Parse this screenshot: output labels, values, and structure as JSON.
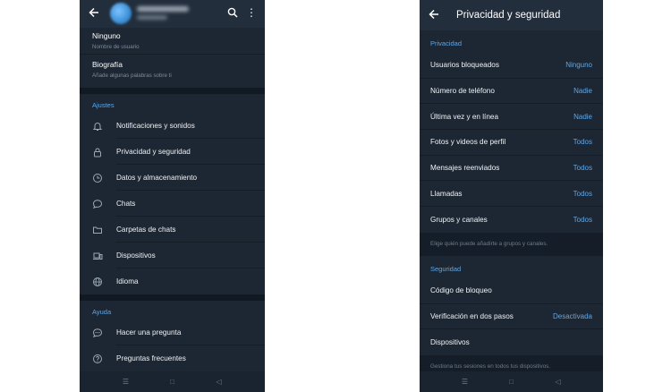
{
  "left_screen": {
    "profile": {
      "username_value": "Ninguno",
      "username_label": "Nombre de usuario",
      "bio_title": "Biografía",
      "bio_hint": "Añade algunas palabras sobre ti"
    },
    "settings_header": "Ajustes",
    "settings_items": [
      {
        "label": "Notificaciones y sonidos",
        "icon": "bell-icon"
      },
      {
        "label": "Privacidad y seguridad",
        "icon": "lock-icon"
      },
      {
        "label": "Datos y almacenamiento",
        "icon": "clock-icon"
      },
      {
        "label": "Chats",
        "icon": "chat-bubble-icon"
      },
      {
        "label": "Carpetas de chats",
        "icon": "folder-icon"
      },
      {
        "label": "Dispositivos",
        "icon": "devices-icon"
      },
      {
        "label": "Idioma",
        "icon": "globe-icon"
      }
    ],
    "help_header": "Ayuda",
    "help_items": [
      {
        "label": "Hacer una pregunta",
        "icon": "chat-dots-icon"
      },
      {
        "label": "Preguntas frecuentes",
        "icon": "question-icon"
      }
    ]
  },
  "right_screen": {
    "title": "Privacidad y seguridad",
    "privacy_header": "Privacidad",
    "privacy_items": [
      {
        "label": "Usuarios bloqueados",
        "value": "Ninguno"
      },
      {
        "label": "Número de teléfono",
        "value": "Nadie"
      },
      {
        "label": "Última vez y en línea",
        "value": "Nadie"
      },
      {
        "label": "Fotos y videos de perfil",
        "value": "Todos"
      },
      {
        "label": "Mensajes reenviados",
        "value": "Todos"
      },
      {
        "label": "Llamadas",
        "value": "Todos"
      },
      {
        "label": "Grupos y canales",
        "value": "Todos"
      }
    ],
    "privacy_hint": "Elige quién puede añadirte a grupos y canales.",
    "security_header": "Seguridad",
    "security_items": [
      {
        "label": "Código de bloqueo",
        "value": ""
      },
      {
        "label": "Verificación en dos pasos",
        "value": "Desactivada"
      },
      {
        "label": "Dispositivos",
        "value": ""
      }
    ],
    "security_hint": "Gestiona tus sesiones en todos tus dispositivos."
  },
  "nav": {
    "recents": "☰",
    "home": "□",
    "back": "◁"
  },
  "colors": {
    "background": "#1d2733",
    "appbar": "#232e3c",
    "accent": "#5fa6e6",
    "divider": "#111a23"
  }
}
